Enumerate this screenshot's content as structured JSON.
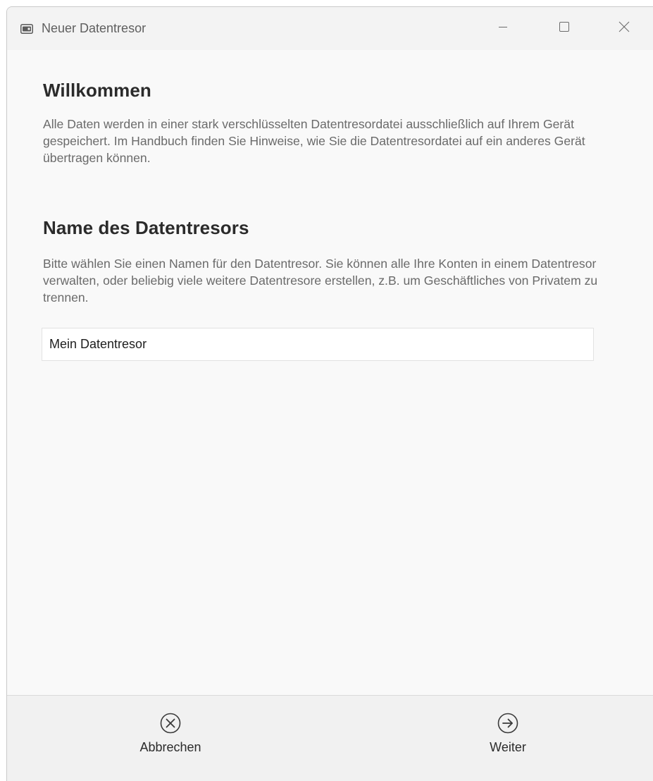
{
  "window": {
    "title": "Neuer Datentresor",
    "icon": "vault-icon",
    "controls": {
      "minimize_icon": "minimize-icon",
      "maximize_icon": "maximize-icon",
      "close_icon": "close-icon"
    }
  },
  "welcome": {
    "heading": "Willkommen",
    "text": "Alle Daten werden in einer stark verschlüsselten Datentresordatei ausschließlich auf Ihrem Gerät gespeichert. Im Handbuch finden Sie Hinweise, wie Sie die Datentresordatei auf ein anderes Gerät übertragen können."
  },
  "vault_name": {
    "heading": "Name des Datentresors",
    "text": "Bitte wählen Sie einen Namen für den Datentresor. Sie können alle Ihre Konten in einem Datentresor verwalten, oder beliebig viele weitere Datentresore erstellen, z.B. um Geschäftliches von Privatem zu trennen.",
    "input_value": "Mein Datentresor"
  },
  "footer": {
    "cancel": {
      "label": "Abbrechen",
      "icon": "cancel-circle-icon"
    },
    "next": {
      "label": "Weiter",
      "icon": "arrow-right-circle-icon"
    }
  },
  "colors": {
    "titlebar_bg": "#f3f3f3",
    "content_bg": "#f9f9f9",
    "footer_bg": "#f1f1f1",
    "heading_text": "#2b2b2b",
    "body_text": "#6a6a6a"
  }
}
